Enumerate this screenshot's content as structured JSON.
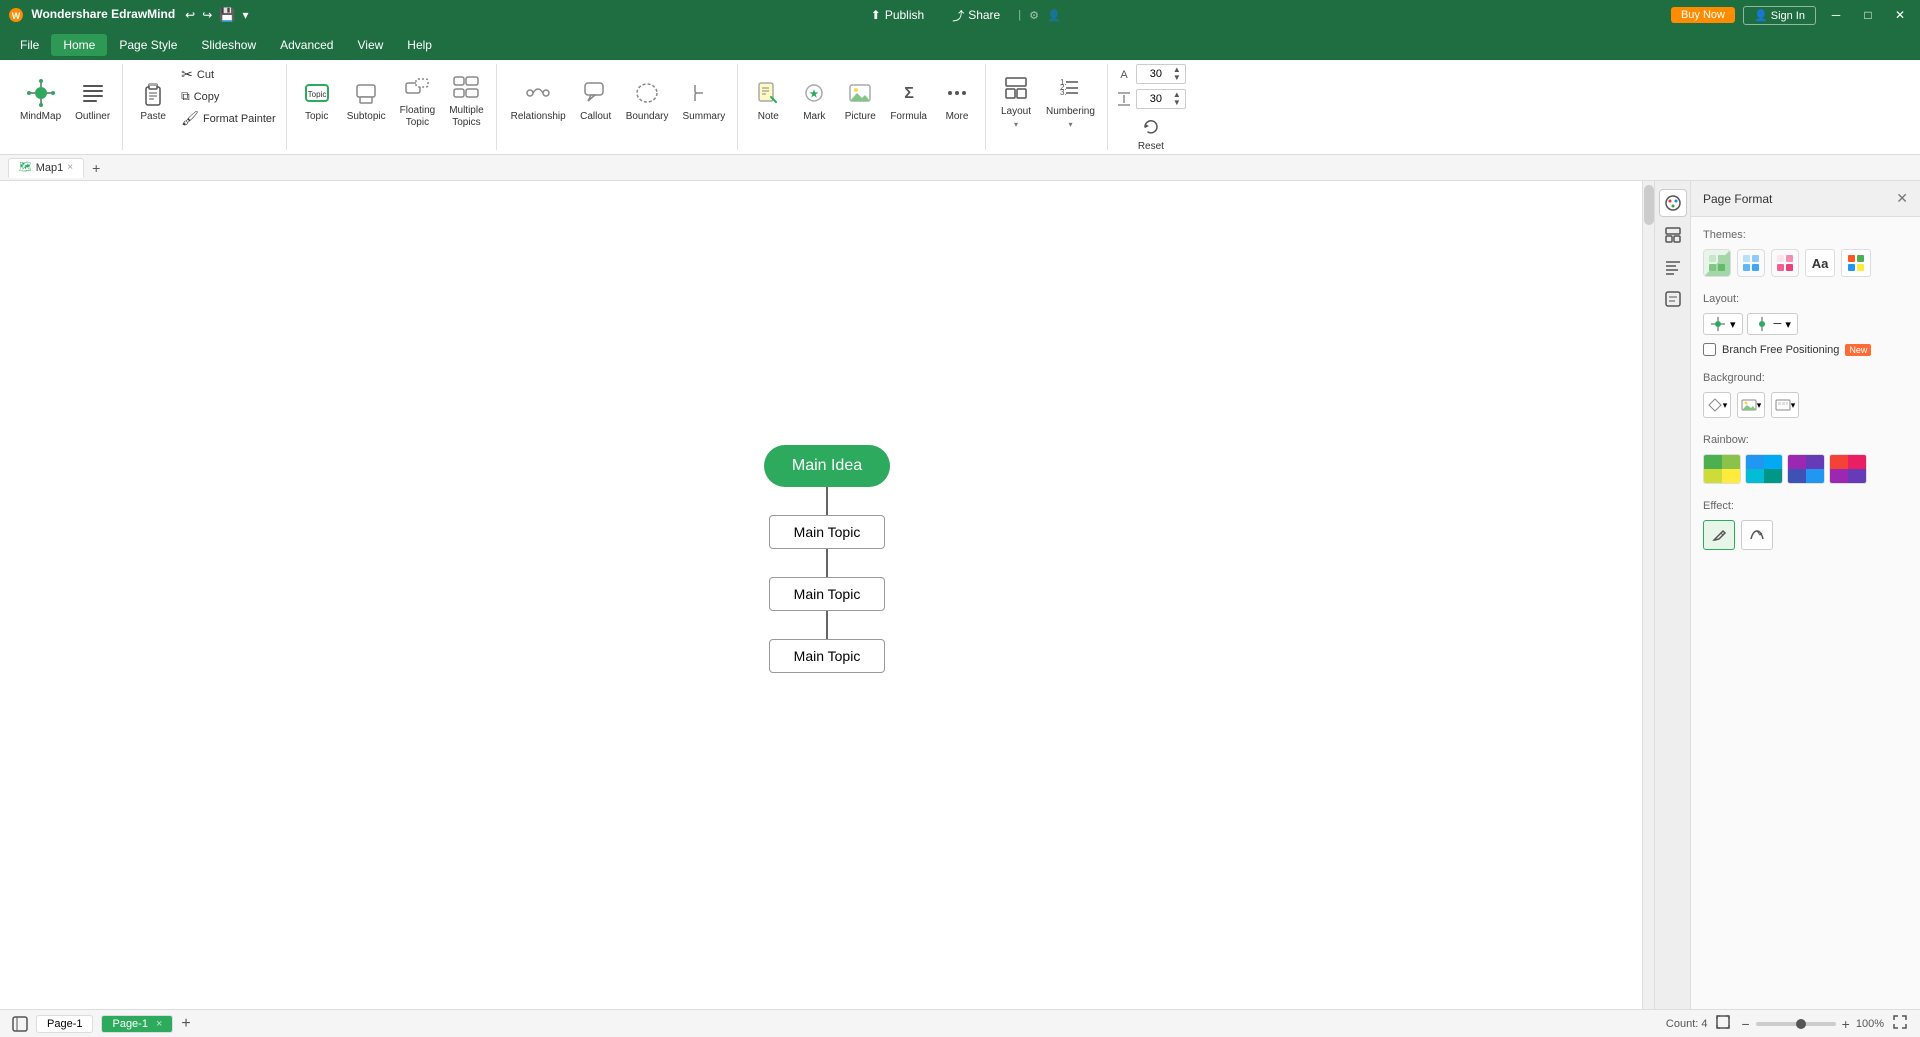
{
  "app": {
    "name": "Wondershare EdrawMind",
    "logo_text": "Wondershare EdrawMind"
  },
  "title_bar": {
    "buy_now_label": "Buy Now",
    "sign_in_label": "Sign In",
    "publish_label": "Publish",
    "share_label": "Share",
    "undo_icon": "↩",
    "redo_icon": "↪"
  },
  "menu": {
    "items": [
      "File",
      "Home",
      "Page Style",
      "Slideshow",
      "Advanced",
      "View",
      "Help"
    ]
  },
  "ribbon": {
    "groups": [
      {
        "name": "mindmap-tools",
        "items": [
          {
            "id": "mindmap",
            "label": "MindMap",
            "icon": "🗺️"
          },
          {
            "id": "outliner",
            "label": "Outliner",
            "icon": "☰"
          }
        ]
      },
      {
        "name": "clipboard",
        "items": [
          {
            "id": "paste",
            "label": "Paste",
            "icon": "📋"
          }
        ],
        "small_items": [
          {
            "id": "cut",
            "label": "Cut",
            "icon": "✂️"
          },
          {
            "id": "copy",
            "label": "Copy",
            "icon": "📄"
          },
          {
            "id": "format-painter",
            "label": "Format\nPainter",
            "icon": "🖌️"
          }
        ]
      },
      {
        "name": "insert-nodes",
        "items": [
          {
            "id": "topic",
            "label": "Topic",
            "icon": "⬜"
          },
          {
            "id": "subtopic",
            "label": "Subtopic",
            "icon": "⬜"
          },
          {
            "id": "floating-topic",
            "label": "Floating\nTopic",
            "icon": "⬛"
          },
          {
            "id": "multiple-topics",
            "label": "Multiple\nTopics",
            "icon": "⣿"
          }
        ]
      },
      {
        "name": "insert-shapes",
        "items": [
          {
            "id": "relationship",
            "label": "Relationship",
            "icon": "↔️"
          },
          {
            "id": "callout",
            "label": "Callout",
            "icon": "💬"
          },
          {
            "id": "boundary",
            "label": "Boundary",
            "icon": "⬡"
          },
          {
            "id": "summary",
            "label": "Summary",
            "icon": "}"
          }
        ]
      },
      {
        "name": "insert-content",
        "items": [
          {
            "id": "note",
            "label": "Note",
            "icon": "📝"
          },
          {
            "id": "mark",
            "label": "Mark",
            "icon": "🏷️"
          },
          {
            "id": "picture",
            "label": "Picture",
            "icon": "🖼️"
          },
          {
            "id": "formula",
            "label": "Formula",
            "icon": "Σ"
          },
          {
            "id": "more",
            "label": "More",
            "icon": "⋯"
          }
        ]
      },
      {
        "name": "view-controls",
        "items": [
          {
            "id": "layout",
            "label": "Layout",
            "icon": "⊟"
          },
          {
            "id": "numbering",
            "label": "Numbering",
            "icon": "1≡"
          }
        ]
      },
      {
        "name": "font-size",
        "font_size_value": "30",
        "font_size_value2": "30",
        "reset_label": "Reset",
        "reset_icon": "↺"
      }
    ]
  },
  "tab": {
    "name": "Map1",
    "close_icon": "×"
  },
  "canvas": {
    "mindmap": {
      "main_idea_label": "Main Idea",
      "topics": [
        "Main Topic",
        "Main Topic",
        "Main Topic"
      ]
    }
  },
  "right_panel": {
    "title": "Page Format",
    "close_icon": "×",
    "sections": {
      "themes": {
        "label": "Themes:",
        "swatches": [
          {
            "id": "grid1",
            "colors": [
              "#e8f5e9",
              "#c8e6c9",
              "#a5d6a7",
              "#81c784"
            ]
          },
          {
            "id": "grid2",
            "colors": [
              "#e3f2fd",
              "#bbdefb",
              "#90caf9",
              "#64b5f6"
            ]
          },
          {
            "id": "grid3",
            "colors": [
              "#fce4ec",
              "#f8bbd9",
              "#f48fb1",
              "#f06292"
            ]
          },
          {
            "id": "font",
            "label": "Aa"
          },
          {
            "id": "color-picker",
            "colors": [
              "#ff0000",
              "#00ff00",
              "#0000ff",
              "#ffff00"
            ]
          }
        ]
      },
      "layout": {
        "label": "Layout:",
        "options": [
          {
            "id": "layout-left",
            "icon": "⊟"
          },
          {
            "id": "layout-right",
            "icon": "⊞"
          },
          {
            "id": "layout-center",
            "icon": "≡"
          },
          {
            "id": "layout-branch",
            "icon": "⊣"
          }
        ],
        "branch_free": {
          "label": "Branch Free Positioning",
          "badge": "New",
          "checked": false
        }
      },
      "background": {
        "label": "Background:",
        "buttons": [
          {
            "id": "bg-color",
            "icon": "◇"
          },
          {
            "id": "bg-image",
            "icon": "🖼"
          },
          {
            "id": "bg-pattern",
            "icon": "⊞"
          }
        ]
      },
      "rainbow": {
        "label": "Rainbow:",
        "options": [
          {
            "id": "r1",
            "colors": [
              "#4caf50",
              "#8bc34a",
              "#cddc39",
              "#ffeb3b"
            ]
          },
          {
            "id": "r2",
            "colors": [
              "#2196f3",
              "#03a9f4",
              "#00bcd4",
              "#009688"
            ]
          },
          {
            "id": "r3",
            "colors": [
              "#9c27b0",
              "#673ab7",
              "#3f51b5",
              "#2196f3"
            ]
          },
          {
            "id": "r4",
            "colors": [
              "#f44336",
              "#e91e63",
              "#9c27b0",
              "#673ab7"
            ]
          }
        ]
      },
      "effect": {
        "label": "Effect:",
        "buttons": [
          {
            "id": "effect-pen",
            "icon": "✏️",
            "active": true
          },
          {
            "id": "effect-fill",
            "icon": "🖊️"
          }
        ]
      }
    }
  },
  "status_bar": {
    "count_label": "Count: 4",
    "pages": [
      {
        "id": "page-1",
        "label": "Page-1"
      }
    ],
    "active_page": "Page-1",
    "zoom_level": "100%",
    "add_page_icon": "+",
    "fit_icon": "⊡",
    "zoom_out_icon": "−",
    "zoom_in_icon": "+"
  },
  "panel_icons": [
    {
      "id": "themes-icon",
      "icon": "🎨",
      "active": true
    },
    {
      "id": "layout-icon",
      "icon": "⊟"
    },
    {
      "id": "format-icon",
      "icon": "⊟"
    },
    {
      "id": "outline-icon",
      "icon": "☰"
    }
  ]
}
